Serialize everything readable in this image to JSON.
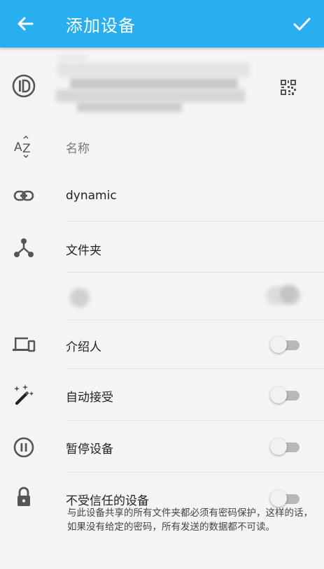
{
  "appbar": {
    "title": "添加设备",
    "back_icon": "arrow-left-icon",
    "confirm_icon": "check-icon",
    "background": "#29aef0"
  },
  "rows": {
    "device_id": {
      "icon": "id-icon",
      "qr_icon": "qr-code-icon"
    },
    "name": {
      "icon": "sort-az-icon",
      "placeholder": "名称"
    },
    "address": {
      "icon": "link-icon",
      "value": "dynamic"
    },
    "folders": {
      "icon": "share-icon",
      "label": "文件夹"
    },
    "introducer": {
      "icon": "devices-icon",
      "label": "介绍人",
      "on": false
    },
    "auto_accept": {
      "icon": "magic-wand-icon",
      "label": "自动接受",
      "on": false
    },
    "pause": {
      "icon": "pause-circle-icon",
      "label": "暂停设备",
      "on": false
    },
    "untrusted": {
      "icon": "lock-icon",
      "label": "不受信任的设备",
      "on": false,
      "description": "与此设备共享的所有文件夹都必须有密码保护，这样的话，如果没有给定的密码，所有发送的数据都不可读。"
    }
  }
}
